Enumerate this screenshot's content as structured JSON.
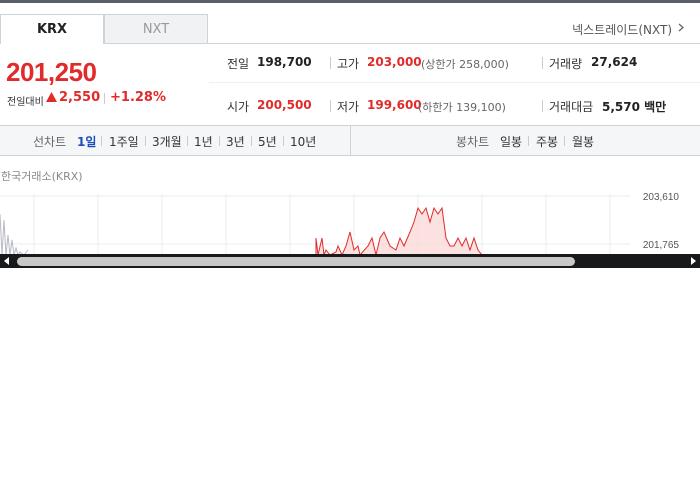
{
  "tabs": [
    {
      "label": "KRX",
      "active": true
    },
    {
      "label": "NXT",
      "active": false
    }
  ],
  "nxt_link": "넥스트레이드(NXT)",
  "price": {
    "current": "201,250",
    "change_label": "전일대비",
    "change_value": "2,550",
    "change_percent": "+1.28%",
    "direction": "up",
    "up_color": "#e12b2b"
  },
  "stats": {
    "prev_close_label": "전일",
    "prev_close": "198,700",
    "high_label": "고가",
    "high": "203,000",
    "upper_limit": "(상한가 258,000)",
    "volume_label": "거래량",
    "volume": "27,624",
    "open_label": "시가",
    "open": "200,500",
    "low_label": "저가",
    "low": "199,600",
    "lower_limit": "(하한가 139,100)",
    "amount_label": "거래대금",
    "amount": "5,570 백만"
  },
  "periods": {
    "line_label": "선차트",
    "line_options": [
      "1일",
      "1주일",
      "3개월",
      "1년",
      "3년",
      "5년",
      "10년"
    ],
    "active": "1일",
    "candle_label": "봉차트",
    "candle_options": [
      "일봉",
      "주봉",
      "월봉"
    ]
  },
  "chart": {
    "source": "한국거래소(KRX)",
    "y_ticks": [
      "203,610",
      "201,765"
    ]
  }
}
